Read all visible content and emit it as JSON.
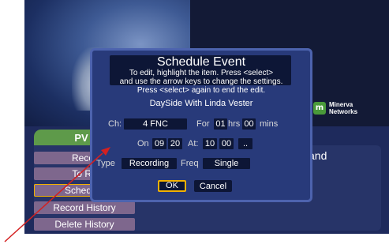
{
  "menu": {
    "tab_label": "PV",
    "items": [
      {
        "label": "Recor"
      },
      {
        "label": "To Re"
      },
      {
        "label": "Schedule"
      },
      {
        "label": "Record History"
      },
      {
        "label": "Delete History"
      }
    ],
    "description": "and"
  },
  "brand": {
    "line1": "Minerva",
    "line2": "Networks",
    "logo": "m"
  },
  "dialog": {
    "title": "Schedule Event",
    "instructions": [
      "To edit, highlight the item.  Press <select>",
      "and use the arrow keys to change the settings.",
      "Press <select> again to end the edit."
    ],
    "show_name": "DaySide With Linda Vester",
    "channel_label": "Ch:",
    "channel_value": "4 FNC",
    "for_label": "For",
    "hours_value": "01",
    "hrs_label": "hrs",
    "mins_value": "00",
    "mins_label": "mins",
    "on_label": "On",
    "month_value": "09",
    "day_value": "20",
    "at_label": "At:",
    "hour_value": "10",
    "minute_value": "00",
    "ampm_value": "..",
    "type_label": "Type",
    "type_value": "Recording",
    "freq_label": "Freq",
    "freq_value": "Single",
    "ok_label": "OK",
    "cancel_label": "Cancel"
  },
  "colors": {
    "accent": "#f2b100",
    "dialog_bg": "#283a7a",
    "field_bg": "#0d1636",
    "menu_item": "#7e678d",
    "arrow": "#d42020"
  }
}
